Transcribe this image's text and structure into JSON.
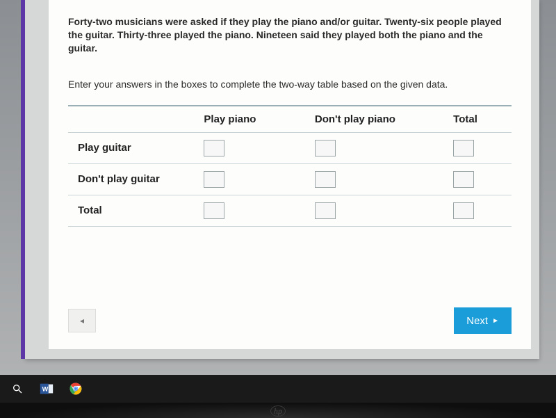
{
  "question": "Forty-two musicians were asked if they play the piano and/or guitar. Twenty-six people played the guitar. Thirty-three played the piano. Nineteen said they played both the piano and the guitar.",
  "instruction": "Enter your answers in the boxes to complete the two-way table based on the given data.",
  "table": {
    "col_headers": {
      "c1": "Play piano",
      "c2": "Don't play piano",
      "c3": "Total"
    },
    "rows": [
      {
        "label": "Play guitar",
        "c1": "",
        "c2": "",
        "c3": ""
      },
      {
        "label": "Don't play guitar",
        "c1": "",
        "c2": "",
        "c3": ""
      },
      {
        "label": "Total",
        "c1": "",
        "c2": "",
        "c3": ""
      }
    ]
  },
  "nav": {
    "prev_glyph": "◂",
    "next_label": "Next",
    "next_glyph": "►"
  },
  "logo": "hp"
}
